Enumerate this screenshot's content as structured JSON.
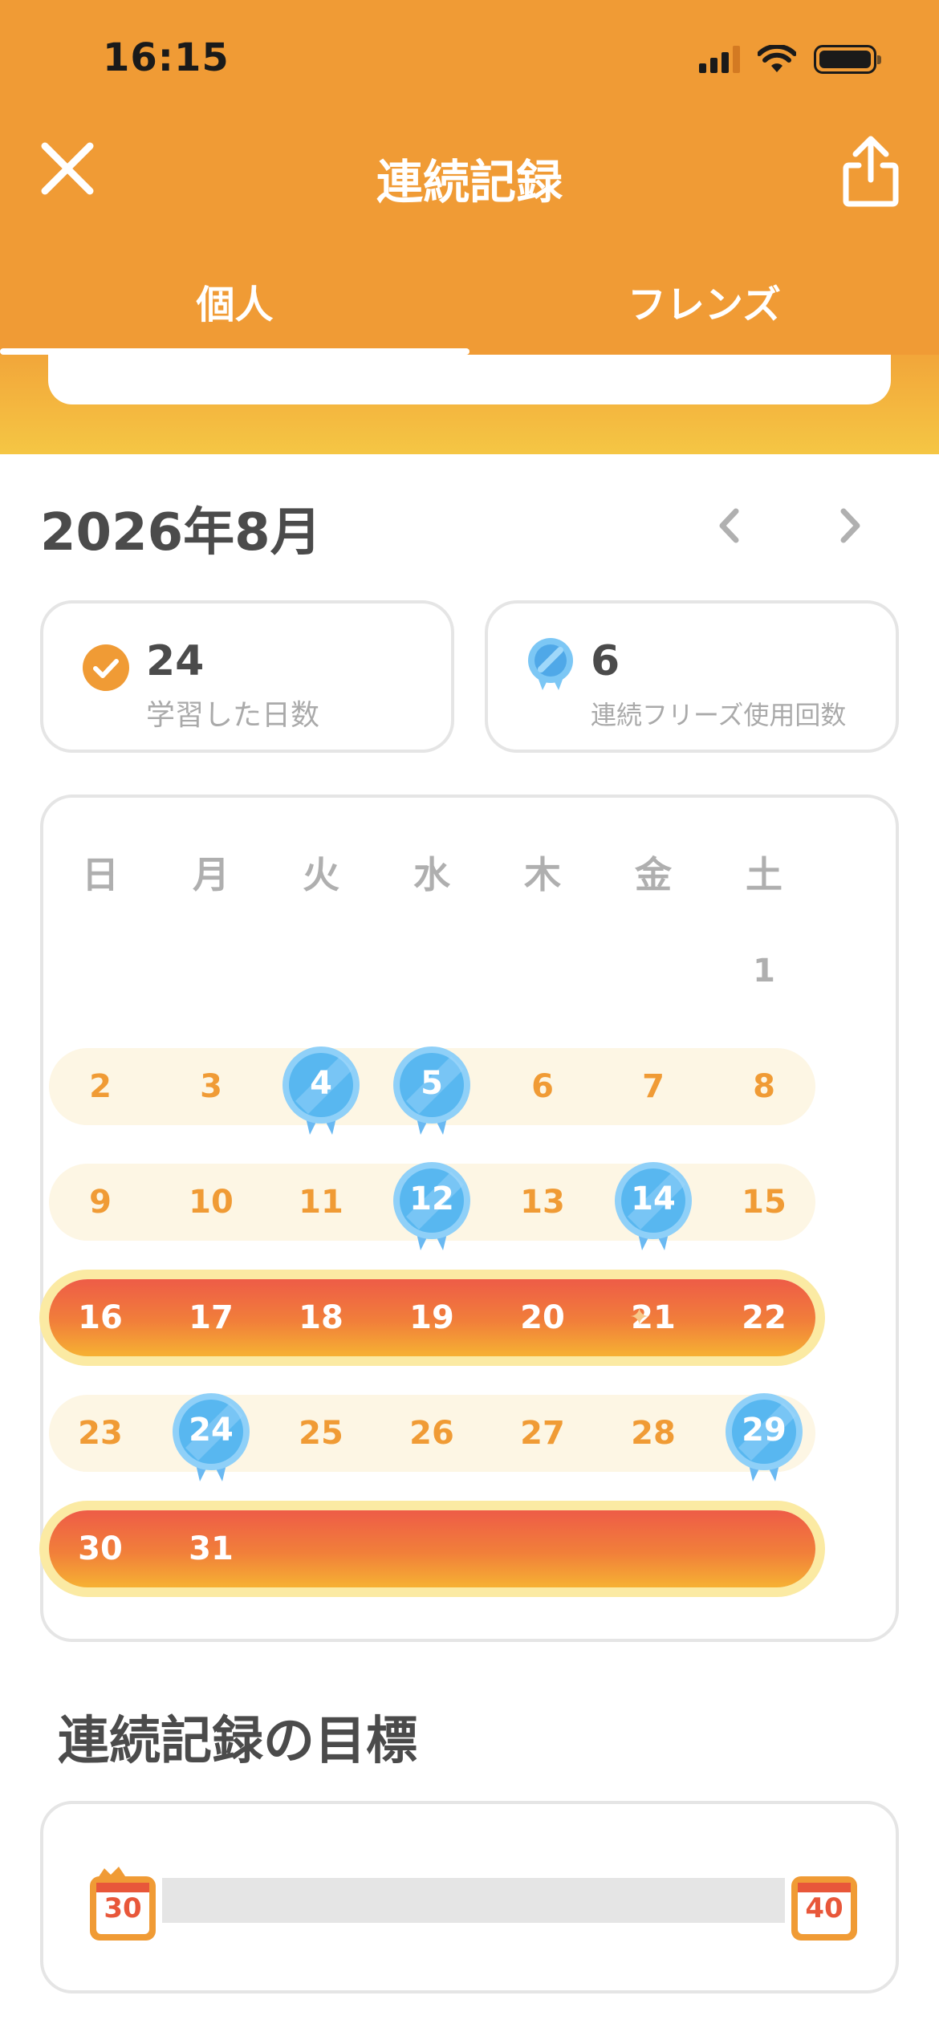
{
  "status_bar": {
    "time": "16:15"
  },
  "header": {
    "title": "連続記録",
    "close_icon": "close-icon",
    "share_icon": "share-icon",
    "tabs": [
      {
        "label": "個人",
        "active": true
      },
      {
        "label": "フレンズ",
        "active": false
      }
    ]
  },
  "colors": {
    "header": "#f09b35",
    "banner_start": "#f2a63a",
    "banner_end": "#f5c644",
    "streak_orange": "#f09b35",
    "streak_hot_start": "#ee5c47",
    "streak_hot_end": "#f6b133",
    "freeze_blue": "#58b7f0",
    "muted": "#afafaf"
  },
  "month": {
    "label": "2026年8月",
    "prev_icon": "chevron-left-icon",
    "next_icon": "chevron-right-icon"
  },
  "stats": [
    {
      "icon": "check-circle-icon",
      "value": "24",
      "label": "学習した日数"
    },
    {
      "icon": "streak-freeze-icon",
      "value": "6",
      "label": "連続フリーズ使用回数"
    }
  ],
  "calendar": {
    "weekdays": [
      "日",
      "月",
      "火",
      "水",
      "木",
      "金",
      "土"
    ],
    "weeks": [
      {
        "style": "none",
        "days": [
          {
            "n": "1",
            "col": 6,
            "state": "plain"
          }
        ]
      },
      {
        "style": "light",
        "days": [
          {
            "n": "2",
            "col": 0,
            "state": "done"
          },
          {
            "n": "3",
            "col": 1,
            "state": "done"
          },
          {
            "n": "4",
            "col": 2,
            "state": "freeze"
          },
          {
            "n": "5",
            "col": 3,
            "state": "freeze"
          },
          {
            "n": "6",
            "col": 4,
            "state": "done"
          },
          {
            "n": "7",
            "col": 5,
            "state": "done"
          },
          {
            "n": "8",
            "col": 6,
            "state": "done"
          }
        ]
      },
      {
        "style": "light",
        "days": [
          {
            "n": "9",
            "col": 0,
            "state": "done"
          },
          {
            "n": "10",
            "col": 1,
            "state": "done"
          },
          {
            "n": "11",
            "col": 2,
            "state": "done"
          },
          {
            "n": "12",
            "col": 3,
            "state": "freeze"
          },
          {
            "n": "13",
            "col": 4,
            "state": "done"
          },
          {
            "n": "14",
            "col": 5,
            "state": "freeze"
          },
          {
            "n": "15",
            "col": 6,
            "state": "done"
          }
        ]
      },
      {
        "style": "hot",
        "days": [
          {
            "n": "16",
            "col": 0,
            "state": "hot"
          },
          {
            "n": "17",
            "col": 1,
            "state": "hot"
          },
          {
            "n": "18",
            "col": 2,
            "state": "hot"
          },
          {
            "n": "19",
            "col": 3,
            "state": "hot"
          },
          {
            "n": "20",
            "col": 4,
            "state": "hot"
          },
          {
            "n": "21",
            "col": 5,
            "state": "hot"
          },
          {
            "n": "22",
            "col": 6,
            "state": "hot"
          }
        ]
      },
      {
        "style": "light",
        "days": [
          {
            "n": "23",
            "col": 0,
            "state": "done"
          },
          {
            "n": "24",
            "col": 1,
            "state": "freeze"
          },
          {
            "n": "25",
            "col": 2,
            "state": "done"
          },
          {
            "n": "26",
            "col": 3,
            "state": "done"
          },
          {
            "n": "27",
            "col": 4,
            "state": "done"
          },
          {
            "n": "28",
            "col": 5,
            "state": "done"
          },
          {
            "n": "29",
            "col": 6,
            "state": "freeze"
          }
        ]
      },
      {
        "style": "hot",
        "days": [
          {
            "n": "30",
            "col": 0,
            "state": "hot"
          },
          {
            "n": "31",
            "col": 1,
            "state": "hot"
          }
        ]
      }
    ]
  },
  "goal": {
    "title": "連続記録の目標",
    "start": "30",
    "end": "40",
    "progress": 0,
    "icon": "calendar-icon"
  }
}
